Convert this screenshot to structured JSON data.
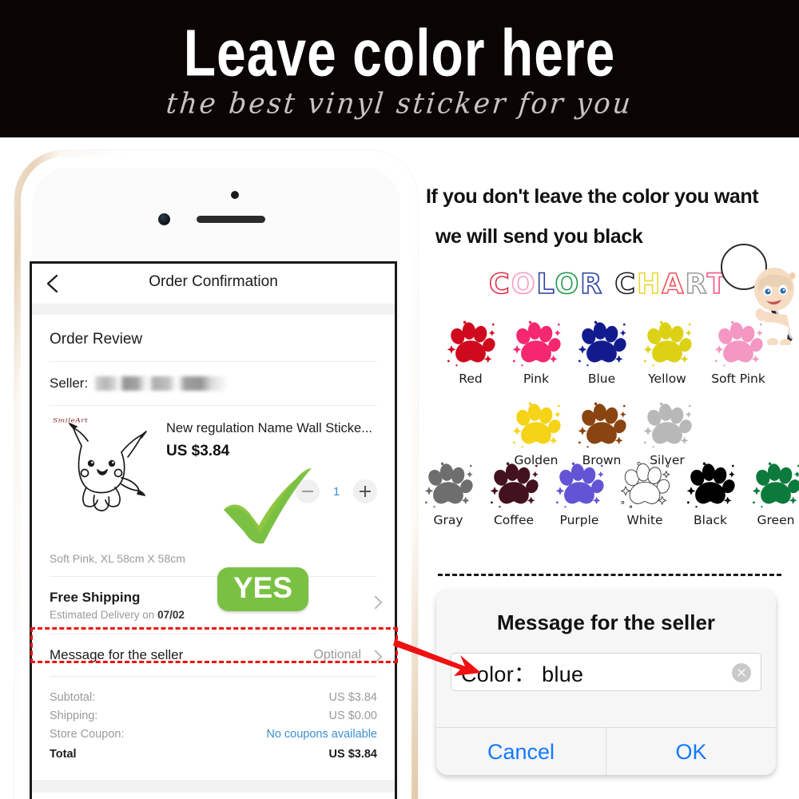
{
  "banner": {
    "title": "Leave color here",
    "subtitle": "the best vinyl sticker for you",
    "background": "#0a0404"
  },
  "notice": {
    "line1": "If you don't leave the color you want",
    "line2": "we will send you black"
  },
  "phone": {
    "navbar": {
      "back_icon": "chevron-left-icon",
      "title": "Order Confirmation"
    },
    "section_title": "Order Review",
    "seller": {
      "label": "Seller:",
      "value_blurred": true
    },
    "item": {
      "brandmark": "SmileArt",
      "name": "New regulation Name Wall Sticke...",
      "price": "US $3.84",
      "variant": "Soft Pink, XL 58cm X 58cm",
      "quantity": "1",
      "minus_label": "−",
      "plus_label": "+"
    },
    "shipping": {
      "title": "Free Shipping",
      "sub_prefix": "Estimated Delivery on ",
      "sub_date": "07/02"
    },
    "message_row": {
      "label": "Message for the seller",
      "value": "Optional"
    },
    "totals": [
      {
        "label": "Subtotal:",
        "value": "US $3.84",
        "link": false,
        "bold": false
      },
      {
        "label": "Shipping:",
        "value": "US $0.00",
        "link": false,
        "bold": false
      },
      {
        "label": "Store Coupon:",
        "value": "No coupons available",
        "link": true,
        "bold": false
      },
      {
        "label": "Total",
        "value": "US $3.84",
        "link": false,
        "bold": true
      }
    ],
    "overlays": {
      "yes_badge": "YES",
      "checkmark_color": "#7ac143",
      "highlight_color": "#ee1111"
    }
  },
  "color_chart": {
    "title_letters": [
      {
        "char": "C",
        "color": "#e0304a"
      },
      {
        "char": "O",
        "color": "#f59ec0"
      },
      {
        "char": "L",
        "color": "#2b3fa0"
      },
      {
        "char": "O",
        "color": "#1f9a4a"
      },
      {
        "char": "R",
        "color": "#2b3fa0"
      },
      {
        "char": " ",
        "color": "#000000"
      },
      {
        "char": "C",
        "color": "#1a1a1a"
      },
      {
        "char": "H",
        "color": "#e8d832"
      },
      {
        "char": "A",
        "color": "#f0545c"
      },
      {
        "char": "R",
        "color": "#9a9a9a"
      },
      {
        "char": "T",
        "color": "#f0567f"
      }
    ],
    "rows": [
      [
        {
          "name": "Red",
          "hex": "#cf0a1e",
          "outline": false
        },
        {
          "name": "Pink",
          "hex": "#f5276e",
          "outline": false
        },
        {
          "name": "Blue",
          "hex": "#121b8e",
          "outline": false
        },
        {
          "name": "Yellow",
          "hex": "#ddd115",
          "outline": false
        },
        {
          "name": "Soft Pink",
          "hex": "#f497c2",
          "outline": false
        }
      ],
      [
        {
          "name": "Golden",
          "hex": "#f5d316",
          "outline": false
        },
        {
          "name": "Brown",
          "hex": "#8a4410",
          "outline": false
        },
        {
          "name": "Silver",
          "hex": "#b8b8b8",
          "outline": false
        }
      ],
      [
        {
          "name": "Gray",
          "hex": "#6e6e6e",
          "outline": false
        },
        {
          "name": "Coffee",
          "hex": "#43121f",
          "outline": false
        },
        {
          "name": "Purple",
          "hex": "#6354d4",
          "outline": false
        },
        {
          "name": "White",
          "hex": "#ffffff",
          "outline": true
        },
        {
          "name": "Black",
          "hex": "#000000",
          "outline": false
        },
        {
          "name": "Green",
          "hex": "#0c7a3c",
          "outline": false
        }
      ]
    ]
  },
  "dialog": {
    "title": "Message for the seller",
    "input_value": "Color： blue",
    "clear_icon": "×",
    "cancel_label": "Cancel",
    "ok_label": "OK",
    "accent": "#1379ff"
  }
}
